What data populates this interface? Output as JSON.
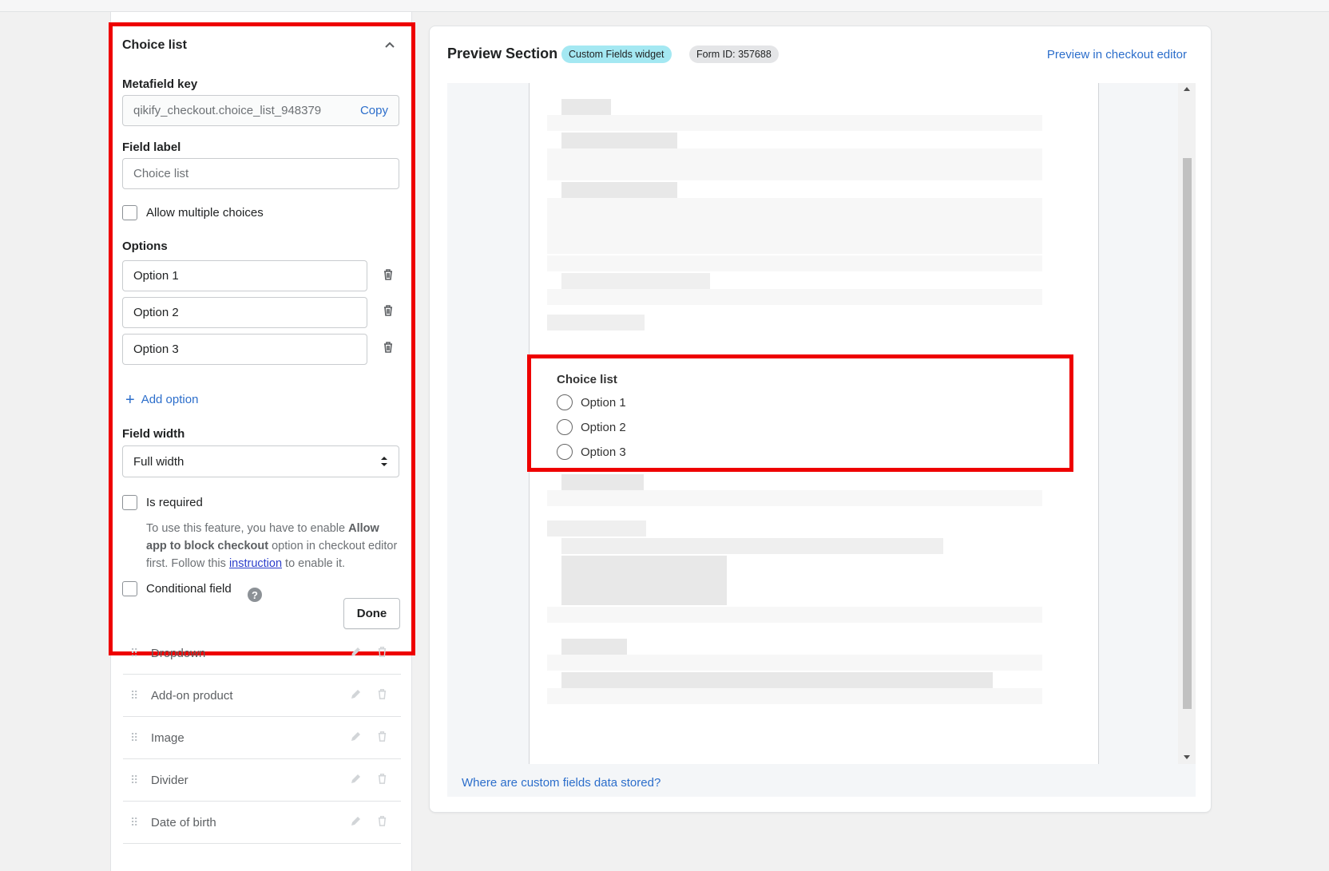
{
  "editor": {
    "title": "Choice list",
    "metafield_key_label": "Metafield key",
    "metafield_key_value": "qikify_checkout.choice_list_948379",
    "copy_label": "Copy",
    "field_label_label": "Field label",
    "field_label_value": "Choice list",
    "allow_multiple_label": "Allow multiple choices",
    "options_label": "Options",
    "options": [
      "Option 1",
      "Option 2",
      "Option 3"
    ],
    "add_option_label": "Add option",
    "field_width_label": "Field width",
    "field_width_value": "Full width",
    "is_required_label": "Is required",
    "required_help_1": "To use this feature, you have to enable ",
    "required_help_bold": "Allow app to block checkout",
    "required_help_2": " option in checkout editor first. Follow this ",
    "required_help_link": "instruction",
    "required_help_3": " to enable it.",
    "conditional_label": "Conditional field",
    "done_label": "Done"
  },
  "field_list": [
    "Dropdown",
    "Add-on product",
    "Image",
    "Divider",
    "Date of birth"
  ],
  "preview": {
    "title": "Preview Section",
    "badge_widget": "Custom Fields widget",
    "badge_form": "Form ID: 357688",
    "editor_link": "Preview in checkout editor",
    "choice_title": "Choice list",
    "choices": [
      "Option 1",
      "Option 2",
      "Option 3"
    ],
    "stored_link": "Where are custom fields data stored?"
  },
  "colors": {
    "accent": "#2c6ecb",
    "highlight": "#ee0000",
    "badge_teal": "#a4e8f2"
  }
}
